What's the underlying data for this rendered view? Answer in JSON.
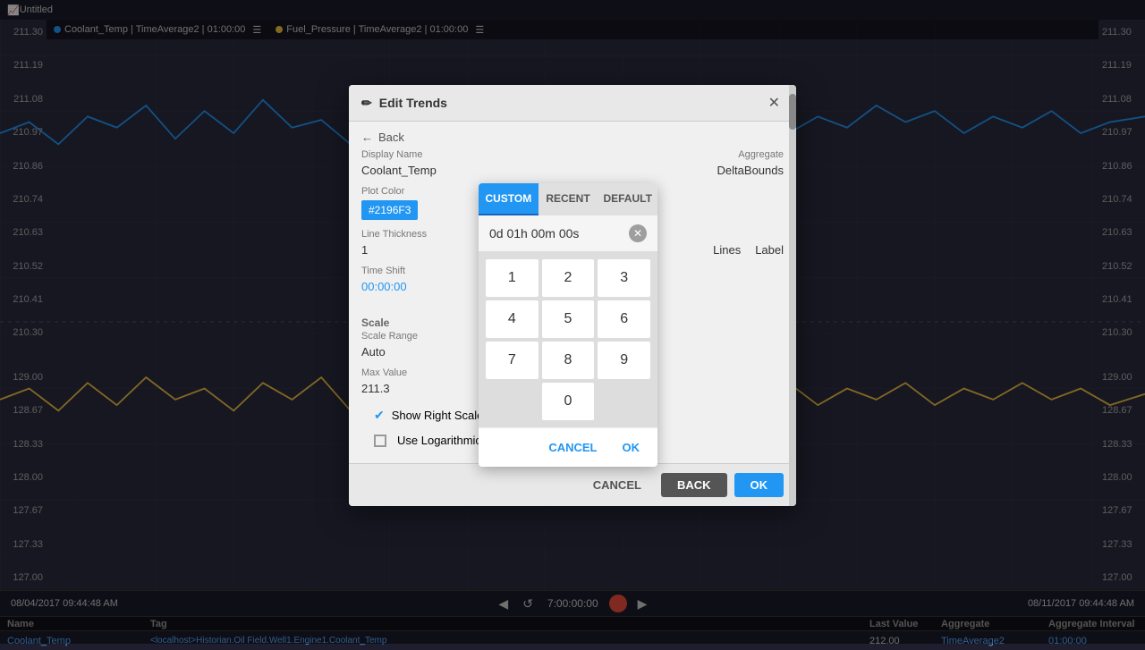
{
  "app": {
    "title": "Untitled",
    "window_icon": "📈"
  },
  "topbar": {
    "legend1": "Coolant_Temp | TimeAverage2 | 01:00:00",
    "legend2": "Fuel_Pressure | TimeAverage2 | 01:00:00",
    "menu_icon": "☰"
  },
  "y_axis_left_top": {
    "values": [
      "211.30",
      "211.19",
      "211.08",
      "210.97",
      "210.86",
      "210.74",
      "210.63",
      "210.52",
      "210.41",
      "210.30"
    ]
  },
  "y_axis_left_bottom": {
    "values": [
      "129.00",
      "128.67",
      "128.33",
      "128.00",
      "127.67",
      "127.33",
      "127.00"
    ]
  },
  "y_axis_right_top": {
    "values": [
      "211.30",
      "211.19",
      "211.08",
      "210.97",
      "210.86",
      "210.74",
      "210.63",
      "210.52",
      "210.41",
      "210.30"
    ]
  },
  "y_axis_right_bottom": {
    "values": [
      "129.00",
      "128.67",
      "128.33",
      "128.00",
      "127.67",
      "127.33",
      "127.00"
    ]
  },
  "bottom": {
    "left_time": "08/04/2017 09:44:48 AM",
    "right_time": "08/11/2017 09:44:48 AM",
    "center_time": "7:00:00:00",
    "nav_prev": "◀",
    "nav_back": "↺",
    "nav_next": "▶"
  },
  "data_table": {
    "headers": [
      "Name",
      "Tag",
      "",
      "Last Value",
      "Aggregate",
      "Aggregate Interval"
    ],
    "row1": {
      "name": "Coolant_Temp",
      "tag": "<localhost>Historian.Oil Field.Well1.Engine1.Coolant_Temp",
      "last_value": "212.00",
      "aggregate": "TimeAverage2",
      "aggregate_interval": "01:00:00"
    },
    "row2": {
      "name": "",
      "tag": "",
      "last_value": "",
      "aggregate": "",
      "aggregate_interval": ""
    }
  },
  "modal": {
    "title": "Edit Trends",
    "close_label": "✕",
    "back_label": "Back",
    "back_arrow": "←",
    "pencil_icon": "✏",
    "display_name_label": "Display Name",
    "display_name_value": "Coolant_Temp",
    "aggregate_label": "Aggregate",
    "aggregate_value": "DeltaBounds",
    "plot_color_label": "Plot Color",
    "plot_color_value": "#2196F3",
    "line_thickness_label": "Line Thickness",
    "line_thickness_value": "1",
    "time_shift_label": "Time Shift",
    "time_shift_value": "00:00:00",
    "show_lines_label": "Lines",
    "show_label_label": "Label",
    "scale_section": "Scale",
    "scale_range_label": "Scale Range",
    "scale_range_value": "Auto",
    "max_value_label": "Max Value",
    "max_value_value": "211.3",
    "show_right_scale_label": "Show Right Scale",
    "use_log_scale_label": "Use Logarithmic Scale",
    "cancel_btn": "CANCEL",
    "back_btn": "BACK",
    "ok_btn": "OK"
  },
  "time_popup": {
    "tab_custom": "CUSTOM",
    "tab_recent": "RECENT",
    "tab_default": "DEFAULT",
    "time_display": "0d 01h 00m 00s",
    "clear_btn": "✕",
    "num1": "1",
    "num2": "2",
    "num3": "3",
    "num4": "4",
    "num5": "5",
    "num6": "6",
    "num7": "7",
    "num8": "8",
    "num9": "9",
    "num0": "0",
    "cancel_btn": "CANCEL",
    "ok_btn": "OK"
  },
  "colors": {
    "accent": "#2196F3",
    "coolant_line": "#2196F3",
    "fuel_line": "#f0c040",
    "background": "#2a2a3e",
    "modal_bg": "#f0f0f0"
  }
}
